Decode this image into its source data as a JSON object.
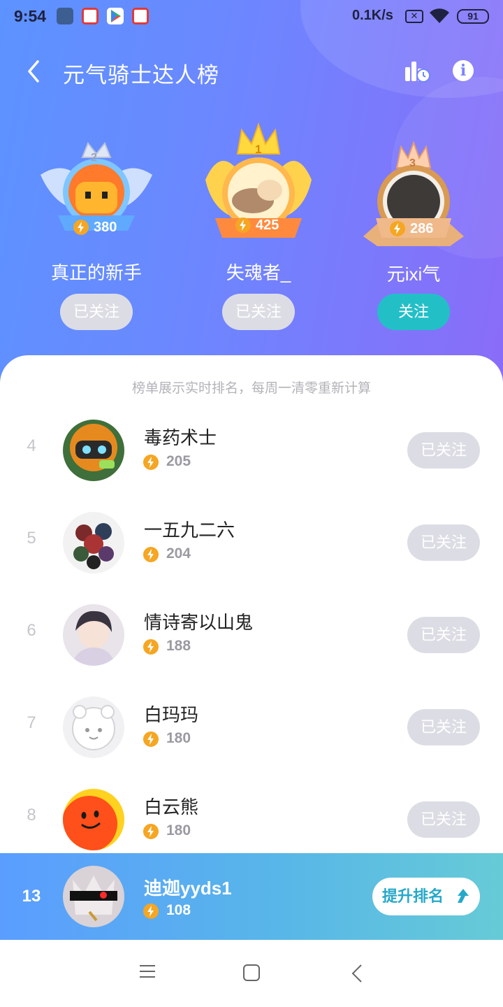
{
  "status_bar": {
    "time": "9:54",
    "network_speed": "0.1K/s",
    "battery": "91",
    "icons": [
      "mi-store-icon",
      "app-icon",
      "play-store-icon",
      "app-icon"
    ]
  },
  "header": {
    "title": "元气骑士达人榜",
    "back_icon": "chevron-left-icon",
    "stats_icon": "ranking-history-icon",
    "info_icon": "info-icon"
  },
  "colors": {
    "accent_teal": "#23bfc7",
    "hero_start": "#5c93ff",
    "hero_end": "#8a6cf8",
    "bolt": "#f5a623"
  },
  "podium": [
    {
      "place": "2",
      "name": "真正的新手",
      "score": "380",
      "follow_label": "已关注",
      "followed": true
    },
    {
      "place": "1",
      "name": "失魂者_",
      "score": "425",
      "follow_label": "已关注",
      "followed": true
    },
    {
      "place": "3",
      "name": "元ixi气",
      "score": "286",
      "follow_label": "关注",
      "followed": false
    }
  ],
  "notice": "榜单展示实时排名，每周一清零重新计算",
  "list": [
    {
      "rank": "4",
      "name": "毒药术士",
      "score": "205",
      "follow_label": "已关注"
    },
    {
      "rank": "5",
      "name": "一五九二六",
      "score": "204",
      "follow_label": "已关注"
    },
    {
      "rank": "6",
      "name": "情诗寄以山鬼",
      "score": "188",
      "follow_label": "已关注"
    },
    {
      "rank": "7",
      "name": "白玛玛",
      "score": "180",
      "follow_label": "已关注"
    },
    {
      "rank": "8",
      "name": "白云熊",
      "score": "180",
      "follow_label": "已关注"
    }
  ],
  "me": {
    "rank": "13",
    "name": "迪迦yyds1",
    "score": "108",
    "boost_label": "提升排名"
  },
  "nav": [
    "menu-icon",
    "home-icon",
    "back-icon"
  ]
}
